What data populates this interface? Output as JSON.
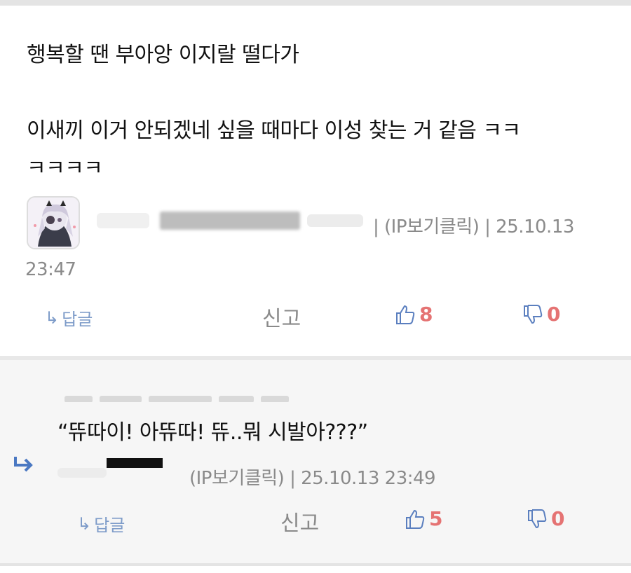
{
  "comment": {
    "lines": [
      "행복할 땐 부아앙 이지랄 떨다가",
      "",
      "이새끼 이거 안되겠네 싶을 때마다 이성 찾는 거 같음 ㅋㅋ",
      "ㅋㅋㅋㅋ"
    ],
    "meta_ip": "| (IP보기클릭) | 25.10.13",
    "meta_time": "23:47",
    "reply_label": "답글",
    "report_label": "신고",
    "upvotes": "8",
    "downvotes": "0"
  },
  "reply": {
    "text": "“뜌따이! 아뜌따! 뜌..뭐 시발아???”",
    "meta": "(IP보기클릭) | 25.10.13 23:49",
    "reply_label": "답글",
    "report_label": "신고",
    "upvotes": "5",
    "downvotes": "0"
  },
  "colors": {
    "accent_blue": "#7e9cc9",
    "vote_red": "#e57373",
    "meta_gray": "#8a8a8a"
  },
  "icons": [
    "avatar-image",
    "reply-arrow-icon",
    "thumbs-up-icon",
    "thumbs-down-icon",
    "reply-indent-arrow-icon"
  ]
}
